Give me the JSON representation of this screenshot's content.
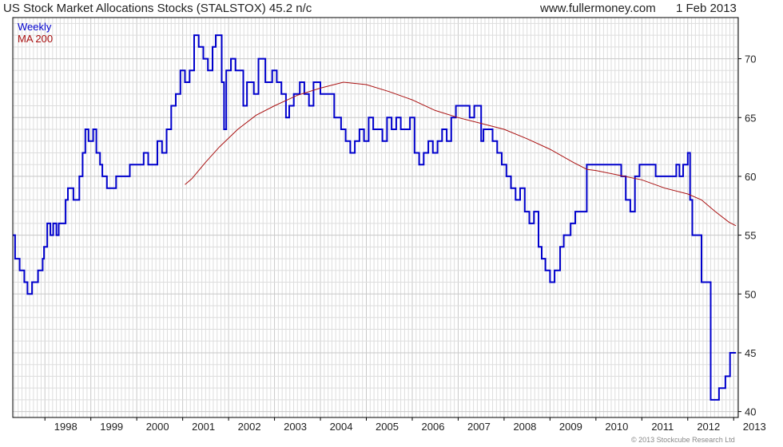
{
  "header": {
    "title": "US Stock Market Allocations Stocks (STALSTOX) 45.2 n/c",
    "website": "www.fullermoney.com",
    "date": "1 Feb 2013"
  },
  "footer": {
    "copyright": "© 2013 Stockcube Research Ltd"
  },
  "colors": {
    "weekly": "#0000cc",
    "ma200": "#aa1111",
    "grid": "#dddddd",
    "frame": "#000000"
  },
  "chart_data": {
    "type": "line",
    "legend_position": "top-left",
    "grid": true,
    "xlim": [
      1997.3,
      2013.1
    ],
    "ylim": [
      39.5,
      73.5
    ],
    "x_ticks": [
      1998,
      1999,
      2000,
      2001,
      2002,
      2003,
      2004,
      2005,
      2006,
      2007,
      2008,
      2009,
      2010,
      2011,
      2012,
      2013
    ],
    "x_tick_labels": [
      "1998",
      "1999",
      "2000",
      "2001",
      "2002",
      "2003",
      "2004",
      "2005",
      "2006",
      "2007",
      "2008",
      "2009",
      "2010",
      "2011",
      "2012",
      "2013"
    ],
    "y_ticks": [
      40,
      45,
      50,
      55,
      60,
      65,
      70
    ],
    "y_tick_labels": [
      "40",
      "45",
      "50",
      "55",
      "60",
      "65",
      "70"
    ],
    "series": [
      {
        "name": "Weekly",
        "step": true,
        "points": [
          [
            1997.3,
            55
          ],
          [
            1997.35,
            53
          ],
          [
            1997.45,
            52
          ],
          [
            1997.55,
            51
          ],
          [
            1997.62,
            50
          ],
          [
            1997.72,
            51
          ],
          [
            1997.85,
            52
          ],
          [
            1997.95,
            53
          ],
          [
            1997.98,
            54
          ],
          [
            1998.05,
            56
          ],
          [
            1998.12,
            55
          ],
          [
            1998.18,
            56
          ],
          [
            1998.25,
            55
          ],
          [
            1998.3,
            56
          ],
          [
            1998.45,
            58
          ],
          [
            1998.5,
            59
          ],
          [
            1998.62,
            58
          ],
          [
            1998.75,
            60
          ],
          [
            1998.82,
            62
          ],
          [
            1998.88,
            64
          ],
          [
            1998.95,
            63
          ],
          [
            1999.05,
            64
          ],
          [
            1999.12,
            62
          ],
          [
            1999.2,
            61
          ],
          [
            1999.25,
            60
          ],
          [
            1999.35,
            59
          ],
          [
            1999.45,
            59
          ],
          [
            1999.55,
            60
          ],
          [
            1999.75,
            60
          ],
          [
            1999.85,
            61
          ],
          [
            2000.0,
            61
          ],
          [
            2000.15,
            62
          ],
          [
            2000.25,
            61
          ],
          [
            2000.45,
            63
          ],
          [
            2000.55,
            62
          ],
          [
            2000.65,
            64
          ],
          [
            2000.75,
            66
          ],
          [
            2000.85,
            67
          ],
          [
            2000.95,
            69
          ],
          [
            2001.05,
            68
          ],
          [
            2001.15,
            69
          ],
          [
            2001.25,
            72
          ],
          [
            2001.35,
            71
          ],
          [
            2001.45,
            70
          ],
          [
            2001.55,
            69
          ],
          [
            2001.65,
            71
          ],
          [
            2001.72,
            72
          ],
          [
            2001.85,
            68
          ],
          [
            2001.9,
            64
          ],
          [
            2001.95,
            69
          ],
          [
            2002.05,
            70
          ],
          [
            2002.15,
            69
          ],
          [
            2002.25,
            69
          ],
          [
            2002.32,
            66
          ],
          [
            2002.4,
            68
          ],
          [
            2002.55,
            67
          ],
          [
            2002.65,
            70
          ],
          [
            2002.8,
            68
          ],
          [
            2002.95,
            69
          ],
          [
            2003.05,
            68
          ],
          [
            2003.15,
            67
          ],
          [
            2003.25,
            65
          ],
          [
            2003.32,
            66
          ],
          [
            2003.42,
            67
          ],
          [
            2003.55,
            68
          ],
          [
            2003.65,
            67
          ],
          [
            2003.75,
            66
          ],
          [
            2003.85,
            68
          ],
          [
            2004.0,
            67
          ],
          [
            2004.15,
            67
          ],
          [
            2004.3,
            65
          ],
          [
            2004.45,
            64
          ],
          [
            2004.55,
            63
          ],
          [
            2004.65,
            62
          ],
          [
            2004.75,
            63
          ],
          [
            2004.85,
            64
          ],
          [
            2004.95,
            63
          ],
          [
            2005.05,
            65
          ],
          [
            2005.15,
            64
          ],
          [
            2005.25,
            64
          ],
          [
            2005.35,
            63
          ],
          [
            2005.45,
            65
          ],
          [
            2005.55,
            64
          ],
          [
            2005.65,
            65
          ],
          [
            2005.75,
            64
          ],
          [
            2005.85,
            64
          ],
          [
            2005.95,
            65
          ],
          [
            2006.05,
            62
          ],
          [
            2006.15,
            61
          ],
          [
            2006.25,
            62
          ],
          [
            2006.35,
            63
          ],
          [
            2006.45,
            62
          ],
          [
            2006.55,
            63
          ],
          [
            2006.65,
            64
          ],
          [
            2006.75,
            63
          ],
          [
            2006.85,
            65
          ],
          [
            2006.95,
            66
          ],
          [
            2007.05,
            66
          ],
          [
            2007.15,
            66
          ],
          [
            2007.25,
            65
          ],
          [
            2007.35,
            66
          ],
          [
            2007.45,
            66
          ],
          [
            2007.5,
            63
          ],
          [
            2007.55,
            64
          ],
          [
            2007.65,
            64
          ],
          [
            2007.75,
            63
          ],
          [
            2007.85,
            62
          ],
          [
            2007.95,
            61
          ],
          [
            2008.05,
            60
          ],
          [
            2008.15,
            59
          ],
          [
            2008.25,
            58
          ],
          [
            2008.35,
            59
          ],
          [
            2008.45,
            57
          ],
          [
            2008.55,
            56
          ],
          [
            2008.65,
            57
          ],
          [
            2008.75,
            54
          ],
          [
            2008.82,
            53
          ],
          [
            2008.9,
            52
          ],
          [
            2009.0,
            51
          ],
          [
            2009.1,
            52
          ],
          [
            2009.22,
            54
          ],
          [
            2009.3,
            55
          ],
          [
            2009.45,
            56
          ],
          [
            2009.55,
            57
          ],
          [
            2009.65,
            57
          ],
          [
            2009.8,
            61
          ],
          [
            2009.95,
            61
          ],
          [
            2010.05,
            61
          ],
          [
            2010.15,
            61
          ],
          [
            2010.3,
            61
          ],
          [
            2010.45,
            61
          ],
          [
            2010.55,
            60
          ],
          [
            2010.65,
            58
          ],
          [
            2010.75,
            57
          ],
          [
            2010.85,
            60
          ],
          [
            2010.95,
            61
          ],
          [
            2011.1,
            61
          ],
          [
            2011.2,
            61
          ],
          [
            2011.3,
            60
          ],
          [
            2011.4,
            60
          ],
          [
            2011.5,
            60
          ],
          [
            2011.6,
            60
          ],
          [
            2011.75,
            61
          ],
          [
            2011.82,
            60
          ],
          [
            2011.9,
            61
          ],
          [
            2012.0,
            62
          ],
          [
            2012.05,
            58
          ],
          [
            2012.1,
            55
          ],
          [
            2012.2,
            55
          ],
          [
            2012.3,
            51
          ],
          [
            2012.4,
            51
          ],
          [
            2012.5,
            41
          ],
          [
            2012.6,
            41
          ],
          [
            2012.68,
            42
          ],
          [
            2012.82,
            43
          ],
          [
            2012.92,
            45
          ],
          [
            2013.05,
            45
          ]
        ]
      },
      {
        "name": "MA 200",
        "points": [
          [
            2001.05,
            59.3
          ],
          [
            2001.2,
            59.8
          ],
          [
            2001.5,
            61.2
          ],
          [
            2001.8,
            62.5
          ],
          [
            2002.2,
            64.0
          ],
          [
            2002.6,
            65.2
          ],
          [
            2003.0,
            66.0
          ],
          [
            2003.5,
            66.9
          ],
          [
            2004.0,
            67.5
          ],
          [
            2004.5,
            68.0
          ],
          [
            2005.0,
            67.8
          ],
          [
            2005.5,
            67.2
          ],
          [
            2006.0,
            66.5
          ],
          [
            2006.5,
            65.6
          ],
          [
            2007.0,
            65.0
          ],
          [
            2007.5,
            64.5
          ],
          [
            2008.0,
            64.0
          ],
          [
            2008.5,
            63.2
          ],
          [
            2009.0,
            62.3
          ],
          [
            2009.5,
            61.2
          ],
          [
            2009.8,
            60.6
          ],
          [
            2010.0,
            60.5
          ],
          [
            2010.5,
            60.1
          ],
          [
            2011.0,
            59.7
          ],
          [
            2011.5,
            59.0
          ],
          [
            2012.0,
            58.5
          ],
          [
            2012.3,
            58.0
          ],
          [
            2012.6,
            57.0
          ],
          [
            2012.9,
            56.1
          ],
          [
            2013.05,
            55.8
          ]
        ]
      }
    ]
  }
}
